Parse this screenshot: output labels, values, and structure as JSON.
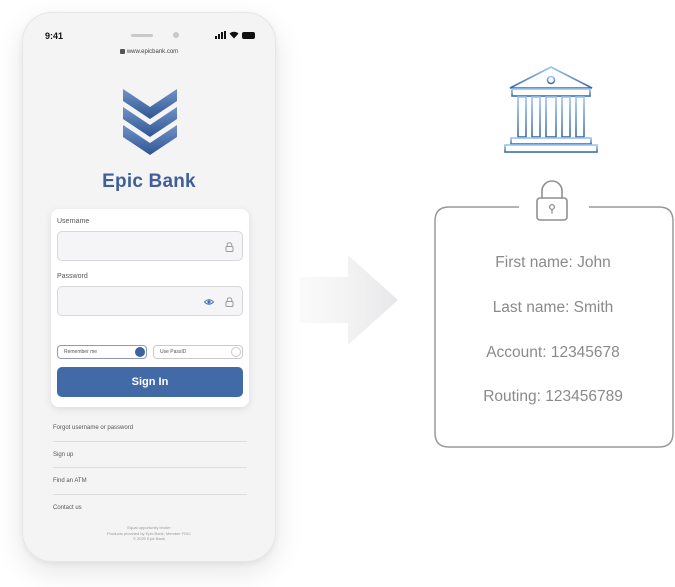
{
  "phone": {
    "status_time": "9:41",
    "url": "www.epicbank.com",
    "brand": "Epic Bank",
    "login": {
      "username_label": "Username",
      "password_label": "Password",
      "remember_me_label": "Remember me",
      "use_passid_label": "Use PassID",
      "sign_in_label": "Sign In"
    },
    "links": [
      "Forgot username or password",
      "Sign up",
      "Find an ATM",
      "Contact us"
    ],
    "footer": [
      "Equal opportunity lender",
      "Products provided by Epic Bank, Member FDIC",
      "© 2020 Epic Bank"
    ]
  },
  "credentials": {
    "first_name": "First name: John",
    "last_name": "Last name: Smith",
    "account": "Account: 12345678",
    "routing": "Routing: 123456789"
  },
  "icons": [
    "bank-building-icon",
    "padlock-icon",
    "arrow-right-icon",
    "shield-chevron-logo",
    "lock-icon",
    "eye-icon",
    "padlock-field-icon"
  ],
  "colors": {
    "brand_blue": "#426aa6",
    "brand_text": "#3f5f98",
    "line_gray": "#9a9a9a",
    "bank_icon_light": "#7fb0df",
    "bank_icon_dark": "#3d6aa8"
  }
}
